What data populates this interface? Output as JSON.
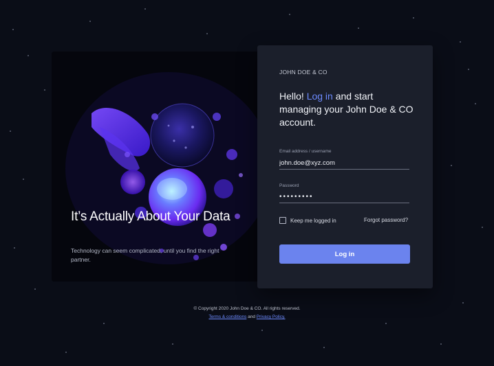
{
  "hero": {
    "title": "It’s Actually About Your Data",
    "subtitle": "Technology can seem complicated, until you find the right partner."
  },
  "login": {
    "brand": "JOHN DOE & CO",
    "headline_prefix": "Hello! ",
    "headline_link": "Log in",
    "headline_suffix": " and start managing your John Doe & CO account.",
    "email_label": "Email address / username",
    "email_value": "john.doe@xyz.com",
    "password_label": "Password",
    "password_value": "•••••••••",
    "remember_label": "Keep me logged in",
    "remember_checked": false,
    "forgot_label": "Forgot password?",
    "submit_label": "Log in"
  },
  "footer": {
    "copyright": "© Copyright 2020 John Doe & CO. All rights reserved.",
    "terms_label": "Terms & conditions",
    "and_text": " and ",
    "privacy_label": "Privacy Policy."
  },
  "colors": {
    "page_bg": "#0a0d17",
    "card_bg": "#1b1f2b",
    "accent": "#6d8bff",
    "button": "#6b83ee"
  }
}
